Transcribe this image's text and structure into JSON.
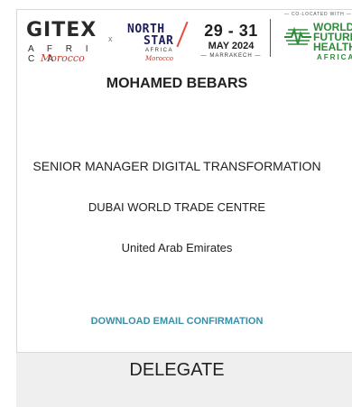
{
  "logos": {
    "gitex": {
      "word": "GITEX",
      "sub": "A F R I C A",
      "script": "Morocco"
    },
    "separator": "x",
    "north_star": {
      "line1": "NORTH",
      "line2": "STAR",
      "sub": "AFRICA",
      "script": "Morocco"
    },
    "date": {
      "days": "29 - 31",
      "month": "MAY 2024",
      "city": "— MARRAKECH —"
    },
    "co_located": "— CO-LOCATED WITH —",
    "world_future_health": {
      "line1": "WORLD",
      "line2": "FUTURE",
      "line3": "HEALTH",
      "sub": "AFRICA"
    }
  },
  "badge": {
    "name": "MOHAMED BEBARS",
    "job_title": "SENIOR MANAGER DIGITAL TRANSFORMATION",
    "company": "DUBAI WORLD TRADE CENTRE",
    "country": "United Arab Emirates",
    "download_link": "DOWNLOAD EMAIL CONFIRMATION",
    "role": "DELEGATE"
  },
  "colors": {
    "accent_link": "#3a8fa6",
    "footer_bg": "#efefef",
    "wfh_green": "#2e8b3a",
    "morocco_red": "#c0392b"
  }
}
